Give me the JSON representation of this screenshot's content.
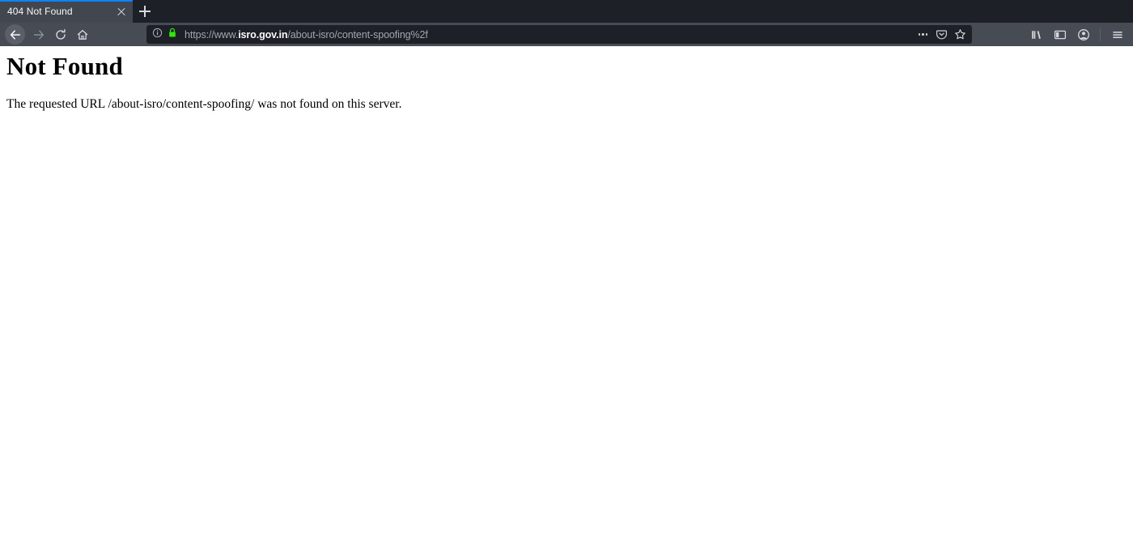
{
  "browser": {
    "tab": {
      "title": "404 Not Found",
      "close_label": "close-tab",
      "accent_color": "#0a84ff"
    },
    "newtab_label": "+",
    "nav": {
      "back_label": "Back",
      "forward_label": "Forward",
      "reload_label": "Reload",
      "home_label": "Home"
    },
    "urlbar": {
      "identity_icon": "page-info-icon",
      "lock_icon": "lock-secure-icon",
      "lock_color": "#30e60b",
      "url_scheme": "https://www.",
      "url_domain": "isro.gov.in",
      "url_path": "/about-isro/content-spoofing%2f",
      "url_full": "https://www.isro.gov.in/about-isro/content-spoofing%2f",
      "page_actions_label": "Page actions",
      "pocket_label": "Save to Pocket",
      "bookmark_label": "Bookmark this page"
    },
    "toolbar_right": {
      "library_label": "Library",
      "sidebar_label": "Sidebars",
      "account_label": "Account",
      "menu_label": "Open application menu"
    }
  },
  "page": {
    "title": "Not Found",
    "message": "The requested URL /about-isro/content-spoofing/ was not found on this server."
  }
}
